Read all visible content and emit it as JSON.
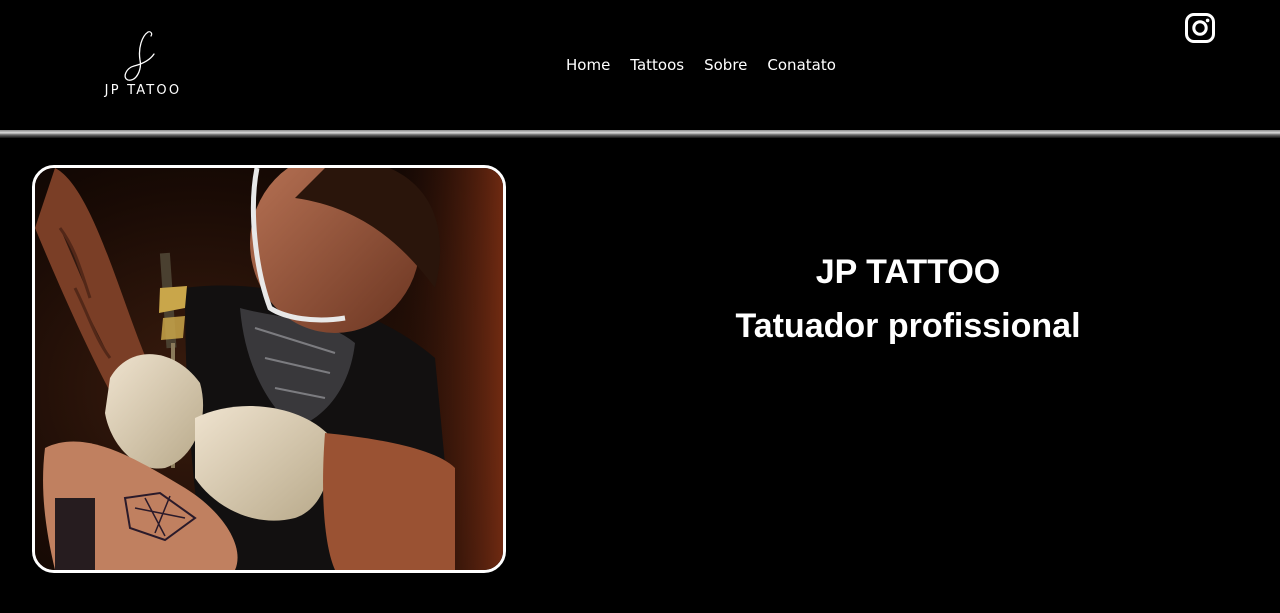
{
  "logo": {
    "mark": "J",
    "text": "JP TATOO"
  },
  "nav": {
    "items": [
      {
        "label": "Home"
      },
      {
        "label": "Tattoos"
      },
      {
        "label": "Sobre"
      },
      {
        "label": "Conatato"
      }
    ]
  },
  "social": {
    "icon": "instagram-icon"
  },
  "hero": {
    "title": "JP TATTOO",
    "subtitle": "Tatuador profissional",
    "image_subject": "tattoo-artist-at-work"
  },
  "colors": {
    "background": "#000000",
    "text": "#ffffff",
    "frame_border": "#ffffff"
  }
}
